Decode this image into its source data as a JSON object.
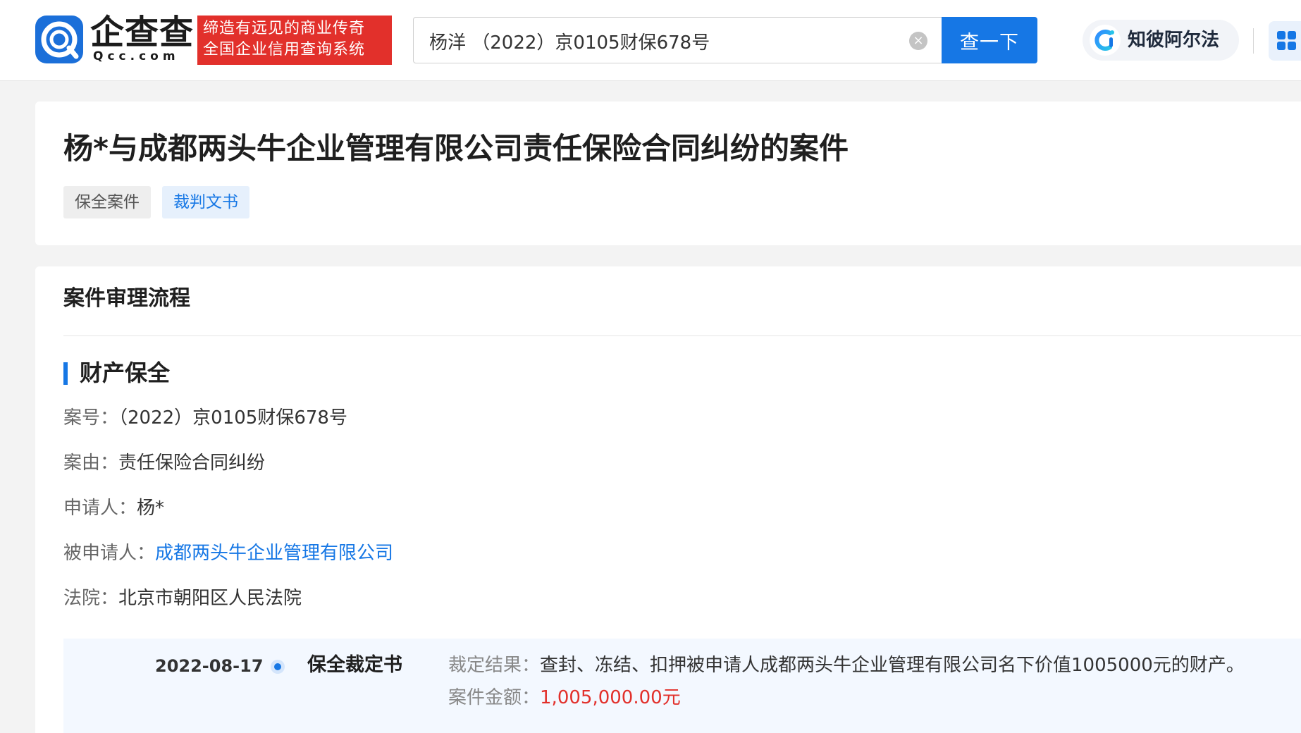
{
  "header": {
    "logo_name": "企查查",
    "logo_domain": "Qcc.com",
    "slogan_line1": "缔造有远见的商业传奇",
    "slogan_line2": "全国企业信用查询系统",
    "search_value": "杨洋 （2022）京0105财保678号",
    "clear_symbol": "×",
    "search_button": "查一下",
    "alpha_label": "知彼阿尔法"
  },
  "title_card": {
    "title": "杨*与成都两头牛企业管理有限公司责任保险合同纠纷的案件",
    "tags": [
      {
        "label": "保全案件"
      },
      {
        "label": "裁判文书"
      }
    ]
  },
  "process": {
    "section_title": "案件审理流程",
    "sub_title": "财产保全",
    "fields": {
      "case_no_label": "案号：",
      "case_no_value": "（2022）京0105财保678号",
      "cause_label": "案由：",
      "cause_value": "责任保险合同纠纷",
      "applicant_label": "申请人：",
      "applicant_value": "杨*",
      "respondent_label": "被申请人：",
      "respondent_value": "成都两头牛企业管理有限公司",
      "court_label": "法院：",
      "court_value": "北京市朝阳区人民法院"
    },
    "timeline": {
      "date": "2022-08-17",
      "doc_type": "保全裁定书",
      "result_label": "裁定结果：",
      "result_value": "查封、冻结、扣押被申请人成都两头牛企业管理有限公司名下价值1005000元的财产。",
      "amount_label": "案件金额：",
      "amount_value": "1,005,000.00元"
    }
  },
  "colors": {
    "brand_blue": "#1677e5",
    "brand_red": "#e2302b",
    "amount_red": "#e2302b"
  },
  "icons": {
    "logo": "qcc-logo-icon",
    "clear": "clear-icon",
    "alpha": "alpha-ai-icon",
    "apps": "apps-grid-icon"
  }
}
